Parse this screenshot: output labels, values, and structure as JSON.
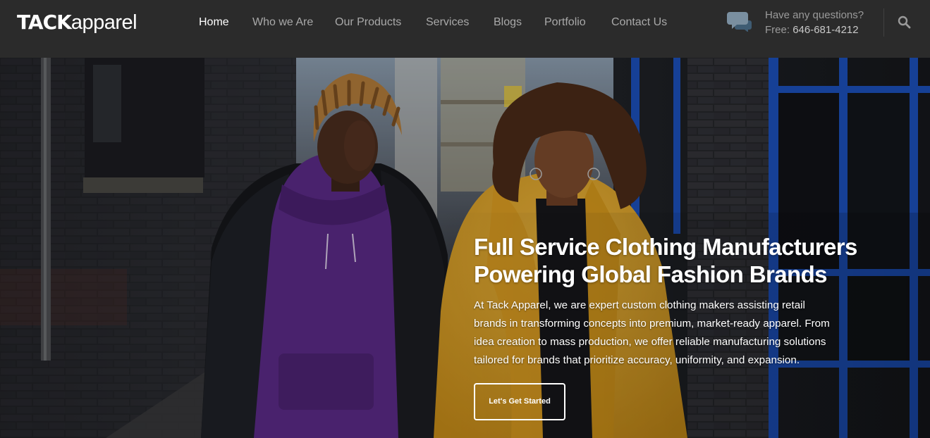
{
  "brand": {
    "logo_bold": "TACK",
    "logo_light": "apparel"
  },
  "nav": [
    {
      "label": "Home",
      "active": true
    },
    {
      "label": "Who we Are"
    },
    {
      "label": "Our Products"
    },
    {
      "label": "Services"
    },
    {
      "label": "Blogs"
    },
    {
      "label": "Portfolio"
    },
    {
      "label": "Contact Us"
    }
  ],
  "contact": {
    "question": "Have any questions?",
    "phone_label": "Free: ",
    "phone_number": "646-681-4212"
  },
  "hero": {
    "title_lines": [
      "Full Service Clothing Manufacturers",
      "Powering Global Fashion Brands"
    ],
    "body_lines": [
      "At Tack Apparel, we are expert custom clothing makers assisting retail",
      "brands in transforming concepts into premium, market-ready apparel. From",
      "idea creation to mass production, we offer reliable manufacturing solutions",
      "tailored for brands that prioritize accuracy, uniformity, and expansion."
    ],
    "cta_label": "Let's Get Started"
  },
  "colors": {
    "header_bg": "#2b2b2b",
    "nav_text": "#a9a9a9",
    "nav_active": "#ffffff",
    "hoodie": "#5a2a86",
    "coat": "#e0a526",
    "window_blue": "#1c4fb8"
  },
  "icons": {
    "chat": "chat-bubble-icon",
    "search": "search-icon"
  }
}
